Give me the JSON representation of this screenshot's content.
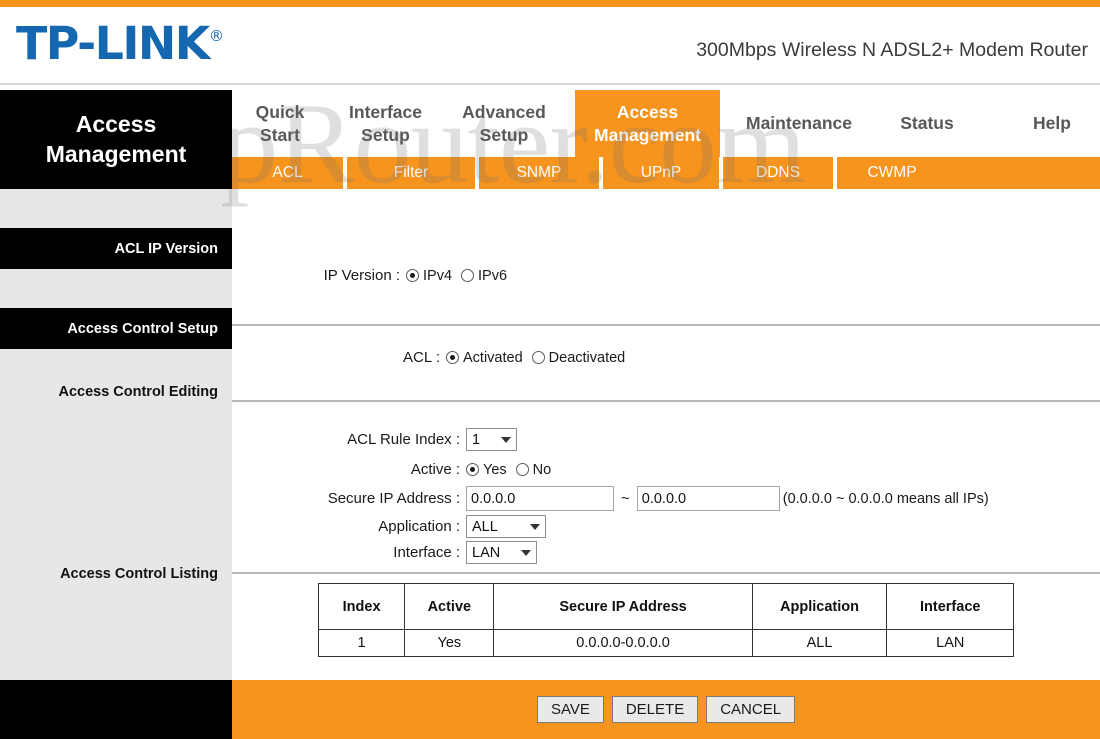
{
  "brand": {
    "logo_text": "TP-LINK",
    "registered_mark": "®",
    "model_line": "300Mbps Wireless N ADSL2+ Modem Router"
  },
  "watermark": "SetupRouter.com",
  "page_banner": {
    "line1": "Access",
    "line2": "Management"
  },
  "nav": {
    "tabs": [
      {
        "label": "Quick Start",
        "line1": "Quick",
        "line2": "Start",
        "active": false
      },
      {
        "label": "Interface Setup",
        "line1": "Interface",
        "line2": "Setup",
        "active": false
      },
      {
        "label": "Advanced Setup",
        "line1": "Advanced",
        "line2": "Setup",
        "active": false
      },
      {
        "label": "Access Management",
        "line1": "Access",
        "line2": "Management",
        "active": true
      },
      {
        "label": "Maintenance",
        "line1": "Maintenance",
        "line2": "",
        "active": false
      },
      {
        "label": "Status",
        "line1": "Status",
        "line2": "",
        "active": false
      },
      {
        "label": "Help",
        "line1": "Help",
        "line2": "",
        "active": false
      }
    ],
    "subtabs": [
      {
        "label": "ACL",
        "active": true
      },
      {
        "label": "Filter",
        "active": false
      },
      {
        "label": "SNMP",
        "active": false
      },
      {
        "label": "UPnP",
        "active": false
      },
      {
        "label": "DDNS",
        "active": false
      },
      {
        "label": "CWMP",
        "active": false
      }
    ]
  },
  "sections": {
    "acl_ip_version": "ACL IP Version",
    "access_control_setup": "Access Control Setup",
    "access_control_editing": "Access Control Editing",
    "access_control_listing": "Access Control Listing"
  },
  "form": {
    "ip_version": {
      "label": "IP Version :",
      "options": [
        {
          "label": "IPv4",
          "selected": true
        },
        {
          "label": "IPv6",
          "selected": false
        }
      ]
    },
    "acl": {
      "label": "ACL :",
      "options": [
        {
          "label": "Activated",
          "selected": true
        },
        {
          "label": "Deactivated",
          "selected": false
        }
      ]
    },
    "acl_rule_index": {
      "label": "ACL Rule Index :",
      "value": "1"
    },
    "active": {
      "label": "Active :",
      "options": [
        {
          "label": "Yes",
          "selected": true
        },
        {
          "label": "No",
          "selected": false
        }
      ]
    },
    "secure_ip_address": {
      "label": "Secure IP Address :",
      "start_value": "0.0.0.0",
      "separator": "~",
      "end_value": "0.0.0.0",
      "hint": "(0.0.0.0 ~ 0.0.0.0 means all IPs)"
    },
    "application": {
      "label": "Application :",
      "value": "ALL"
    },
    "interface": {
      "label": "Interface :",
      "value": "LAN"
    }
  },
  "listing_table": {
    "headers": [
      "Index",
      "Active",
      "Secure IP Address",
      "Application",
      "Interface"
    ],
    "rows": [
      [
        "1",
        "Yes",
        "0.0.0.0-0.0.0.0",
        "ALL",
        "LAN"
      ]
    ]
  },
  "footer_buttons": [
    {
      "label": "SAVE"
    },
    {
      "label": "DELETE"
    },
    {
      "label": "CANCEL"
    }
  ],
  "colors": {
    "accent_orange": "#f7941e",
    "brand_blue": "#1568b0",
    "rail_gray": "#e7e7e7",
    "black": "#000000"
  }
}
